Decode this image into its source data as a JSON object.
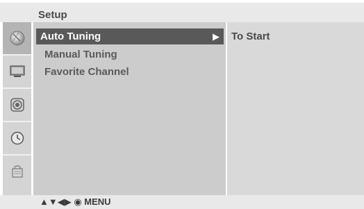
{
  "header": {
    "title": "Setup"
  },
  "sidebar": {
    "icons": [
      {
        "name": "satellite-dish-icon",
        "active": true
      },
      {
        "name": "tv-monitor-icon",
        "active": false
      },
      {
        "name": "speaker-icon",
        "active": false
      },
      {
        "name": "clock-icon",
        "active": false
      },
      {
        "name": "lock-icon",
        "active": false
      }
    ]
  },
  "menu": {
    "items": [
      {
        "label": "Auto Tuning",
        "selected": true
      },
      {
        "label": "Manual Tuning",
        "selected": false
      },
      {
        "label": "Favorite Channel",
        "selected": false
      }
    ],
    "selected_arrow": "▶"
  },
  "submenu": {
    "items": [
      {
        "label": "To Start"
      }
    ]
  },
  "footer": {
    "nav_hint": "▲▼◀▶ ◉ MENU"
  },
  "colors": {
    "selected_bg": "#595959",
    "menu_bg": "#cccccc",
    "submenu_bg": "#d9d9d9",
    "bar_bg": "#e9e9e9"
  }
}
